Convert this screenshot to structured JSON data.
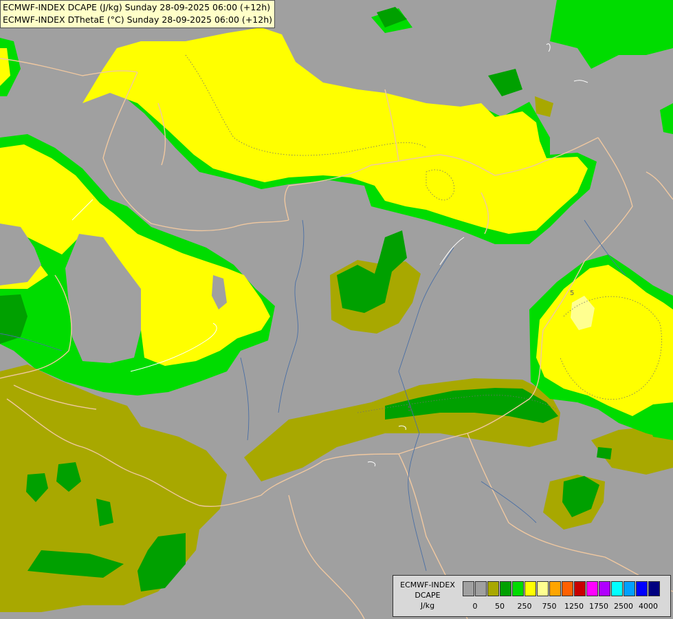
{
  "title": {
    "line1": "ECMWF-INDEX DCAPE (J/kg) Sunday 28-09-2025 06:00 (+12h)",
    "line2": "ECMWF-INDEX DThetaE (°C) Sunday 28-09-2025 06:00 (+12h)"
  },
  "map": {
    "background_color": "#a0a0a0",
    "border_color": "#f0c8a0",
    "river_color": "#4a6fa5",
    "contour_labels": [
      "5",
      "5"
    ]
  },
  "legend": {
    "name_lines": [
      "ECMWF-INDEX",
      "DCAPE",
      "J/kg"
    ],
    "colors": [
      "#a0a0a0",
      "#a0a0a0",
      "#a8a800",
      "#00a000",
      "#00dc00",
      "#ffff00",
      "#ffff90",
      "#ffa500",
      "#ff6000",
      "#c80000",
      "#ff00ff",
      "#b000ff",
      "#00ffff",
      "#00a0ff",
      "#0000ff",
      "#000080"
    ],
    "tick_labels": [
      "0",
      "50",
      "250",
      "750",
      "1250",
      "1750",
      "2500",
      "4000"
    ]
  }
}
